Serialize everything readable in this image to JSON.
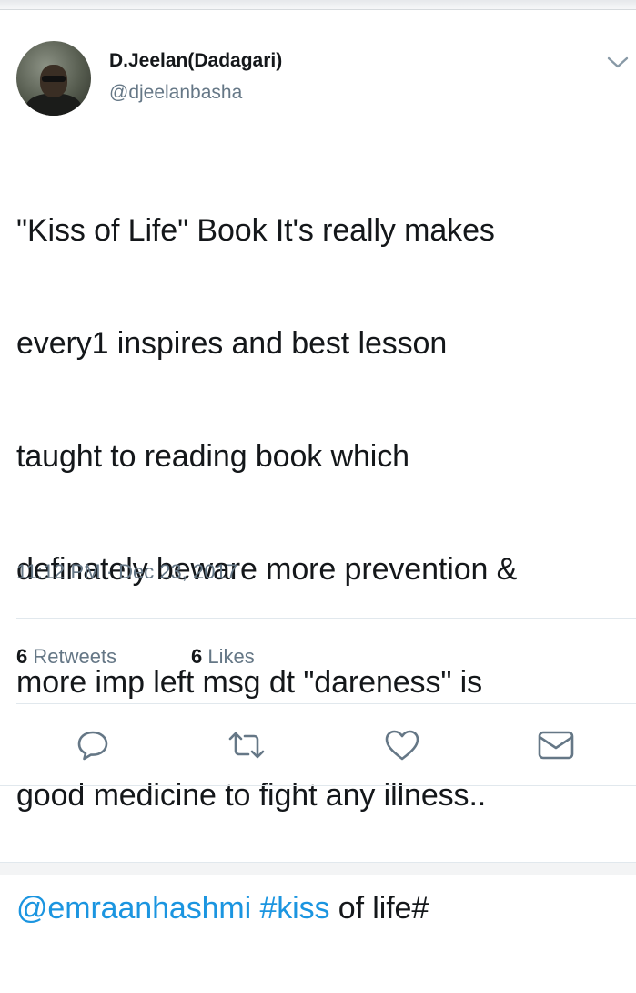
{
  "author": {
    "display_name": "D.Jeelan(Dadagari)",
    "handle": "@djeelanbasha"
  },
  "tweet": {
    "lines": [
      "\"Kiss of Life\" Book It's really makes",
      "every1 inspires and best lesson",
      "taught to reading book which",
      "definately beware more prevention &",
      "more imp left msg dt \"dareness\" is",
      "good medicine to fight any illness.."
    ],
    "last_line": {
      "mention": "@emraanhashmi",
      "hashtag": "#kiss",
      "trailing_text": " of life#"
    },
    "timestamp": "11:12 PM · Dec 23, 2017"
  },
  "stats": {
    "retweets_count": "6",
    "retweets_label": " Retweets",
    "likes_count": "6",
    "likes_label": " Likes"
  },
  "icons": {
    "menu": "chevron-down-icon",
    "reply": "reply-icon",
    "retweet": "retweet-icon",
    "like": "heart-icon",
    "dm": "envelope-icon"
  },
  "colors": {
    "link": "#1b95e0",
    "secondary_text": "#657786",
    "icon": "#657786",
    "divider": "#e1e8ed"
  }
}
